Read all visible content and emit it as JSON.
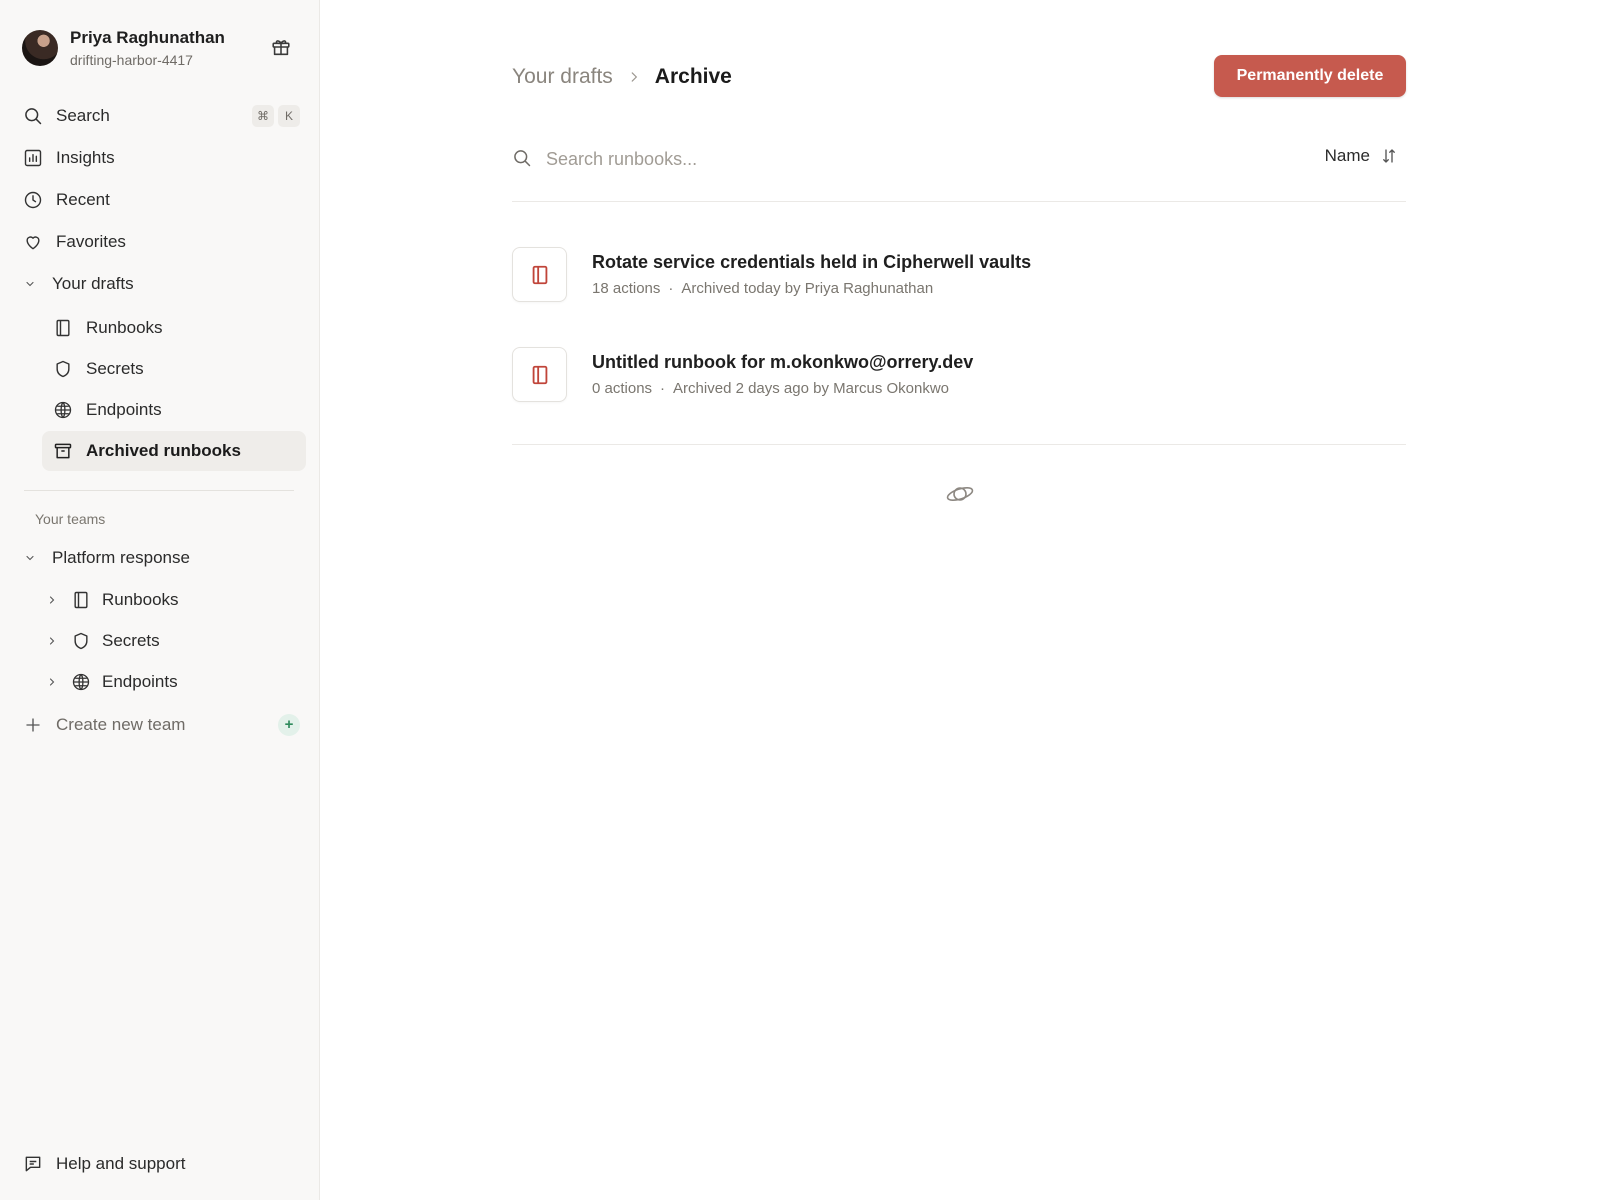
{
  "user": {
    "name": "Priya Raghunathan",
    "workspace": "drifting-harbor-4417"
  },
  "nav": {
    "search": {
      "label": "Search",
      "shortcut_mod": "⌘",
      "shortcut_key": "K"
    },
    "insights": "Insights",
    "recent": "Recent",
    "favorites": "Favorites",
    "drafts": "Your drafts"
  },
  "drafts_items": {
    "runbooks": "Runbooks",
    "secrets": "Secrets",
    "endpoints": "Endpoints",
    "archived": "Archived runbooks"
  },
  "teams": {
    "section_label": "Your teams",
    "team_name": "Platform response",
    "items": {
      "runbooks": "Runbooks",
      "secrets": "Secrets",
      "endpoints": "Endpoints"
    },
    "create_label": "Create new team",
    "create_badge": "+"
  },
  "help": "Help and support",
  "header": {
    "breadcrumb_parent": "Your drafts",
    "breadcrumb_current": "Archive",
    "delete_label": "Permanently delete"
  },
  "search": {
    "placeholder": "Search runbooks...",
    "sort_label": "Name"
  },
  "runbooks": [
    {
      "title": "Rotate service credentials held in Cipherwell vaults",
      "actions": "18 actions",
      "archived": "Archived today by Priya Raghunathan"
    },
    {
      "title": "Untitled runbook for m.okonkwo@orrery.dev",
      "actions": "0 actions",
      "archived": "Archived 2 days ago by Marcus Okonkwo"
    }
  ],
  "meta_separator": "·",
  "colors": {
    "accent_danger": "#c65a4e",
    "runbook_icon": "#c0453a",
    "sidebar_bg": "#f9f8f7",
    "active_item_bg": "#efedea"
  }
}
